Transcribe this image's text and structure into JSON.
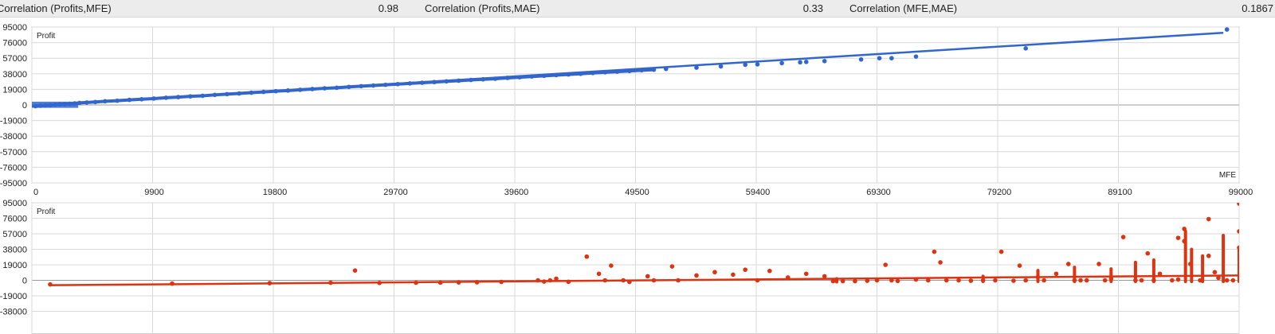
{
  "stats": [
    {
      "label": "Correlation (Profits,MFE)",
      "value": "0.98"
    },
    {
      "label": "Correlation (Profits,MAE)",
      "value": "0.33"
    },
    {
      "label": "Correlation (MFE,MAE)",
      "value": "0.1867"
    }
  ],
  "colors": {
    "mfe_series": "#3366cc",
    "mae_series": "#dd3311",
    "grid": "#d9d9d9",
    "axis": "#9a9a9a"
  },
  "chart_data": [
    {
      "type": "scatter",
      "title": "",
      "ylabel": "Profit",
      "xlabel": "MFE",
      "ylim": [
        -95000,
        95000
      ],
      "xlim": [
        0,
        99000
      ],
      "yticks": [
        95000,
        76000,
        57000,
        38000,
        19000,
        0,
        -19000,
        -38000,
        -57000,
        -76000,
        -95000
      ],
      "yticklabels": [
        "95000",
        "76000",
        "57000",
        "38000",
        "19000",
        "0",
        "-19000",
        "-38000",
        "-57000",
        "-76000",
        "-95000"
      ],
      "xticks": [
        0,
        9900,
        19800,
        29700,
        39600,
        49500,
        59400,
        69300,
        79200,
        89100,
        99000
      ],
      "xticklabels": [
        "0",
        "9900",
        "19800",
        "29700",
        "39600",
        "49500",
        "59400",
        "69300",
        "79200",
        "89100",
        "99000"
      ],
      "grid": true,
      "trendline": {
        "x": [
          0,
          97700
        ],
        "y": [
          -1500,
          88000
        ]
      },
      "points": [
        [
          300,
          -1500
        ],
        [
          700,
          -900
        ],
        [
          1100,
          -400
        ],
        [
          1500,
          -300
        ],
        [
          1900,
          300
        ],
        [
          2300,
          800
        ],
        [
          2700,
          1100
        ],
        [
          3100,
          1400
        ],
        [
          3500,
          1900
        ],
        [
          3900,
          2500
        ],
        [
          4500,
          3000
        ],
        [
          5200,
          3600
        ],
        [
          6000,
          4500
        ],
        [
          7000,
          5200
        ],
        [
          8000,
          6200
        ],
        [
          9000,
          7000
        ],
        [
          10000,
          7800
        ],
        [
          11000,
          8800
        ],
        [
          12000,
          9600
        ],
        [
          13000,
          10500
        ],
        [
          14000,
          11200
        ],
        [
          15000,
          12300
        ],
        [
          16000,
          13200
        ],
        [
          17000,
          14000
        ],
        [
          18000,
          15000
        ],
        [
          19000,
          15900
        ],
        [
          20000,
          16800
        ],
        [
          21000,
          17600
        ],
        [
          22000,
          18500
        ],
        [
          23000,
          19400
        ],
        [
          24000,
          20300
        ],
        [
          25000,
          21000
        ],
        [
          26000,
          22000
        ],
        [
          27000,
          22900
        ],
        [
          28000,
          23700
        ],
        [
          29000,
          24600
        ],
        [
          30000,
          25400
        ],
        [
          31000,
          26300
        ],
        [
          32000,
          27100
        ],
        [
          33000,
          27900
        ],
        [
          34000,
          28800
        ],
        [
          35000,
          29600
        ],
        [
          36000,
          30500
        ],
        [
          37000,
          31300
        ],
        [
          38000,
          32000
        ],
        [
          39000,
          33000
        ],
        [
          40000,
          33800
        ],
        [
          41000,
          34700
        ],
        [
          42000,
          35500
        ],
        [
          43000,
          36400
        ],
        [
          44000,
          37200
        ],
        [
          45000,
          38000
        ],
        [
          46000,
          39000
        ],
        [
          47000,
          39800
        ],
        [
          48000,
          40600
        ],
        [
          49000,
          41400
        ],
        [
          50000,
          42300
        ],
        [
          51000,
          43000
        ],
        [
          52000,
          44000
        ],
        [
          54500,
          45500
        ],
        [
          56500,
          47000
        ],
        [
          58500,
          49000
        ],
        [
          59500,
          49500
        ],
        [
          61500,
          51000
        ],
        [
          63000,
          52000
        ],
        [
          63500,
          52500
        ],
        [
          65000,
          53500
        ],
        [
          68000,
          55500
        ],
        [
          69500,
          57000
        ],
        [
          70500,
          57000
        ],
        [
          72500,
          59000
        ],
        [
          81500,
          69000
        ],
        [
          98000,
          92000
        ]
      ]
    },
    {
      "type": "scatter",
      "title": "",
      "ylabel": "Profit",
      "xlabel": "",
      "ylim": [
        -95000,
        95000
      ],
      "xlim": [
        0,
        99000
      ],
      "yticks": [
        95000,
        76000,
        57000,
        38000,
        19000,
        0,
        -19000,
        -38000
      ],
      "yticklabels": [
        "95000",
        "76000",
        "57000",
        "38000",
        "19000",
        "0",
        "-19000",
        "-38000"
      ],
      "grid": true,
      "trendline": {
        "x": [
          1500,
          99000
        ],
        "y": [
          -6000,
          6000
        ]
      },
      "points": [
        [
          1500,
          -5000
        ],
        [
          11500,
          -4000
        ],
        [
          19500,
          -3500
        ],
        [
          24500,
          -3000
        ],
        [
          26500,
          12000
        ],
        [
          28500,
          -3200
        ],
        [
          31500,
          -3000
        ],
        [
          33500,
          -2800
        ],
        [
          35000,
          -2600
        ],
        [
          36500,
          -2400
        ],
        [
          38500,
          -2000
        ],
        [
          41500,
          0
        ],
        [
          42000,
          -1500
        ],
        [
          42500,
          0
        ],
        [
          43000,
          2000
        ],
        [
          44000,
          -1800
        ],
        [
          45500,
          29000
        ],
        [
          46500,
          8000
        ],
        [
          47000,
          0
        ],
        [
          47500,
          18000
        ],
        [
          48500,
          0
        ],
        [
          49000,
          -2000
        ],
        [
          50500,
          5000
        ],
        [
          51000,
          0
        ],
        [
          52500,
          17000
        ],
        [
          53000,
          0
        ],
        [
          54500,
          6000
        ],
        [
          56000,
          10000
        ],
        [
          57500,
          7000
        ],
        [
          58500,
          13000
        ],
        [
          59500,
          0
        ],
        [
          60500,
          11500
        ],
        [
          62000,
          3500
        ],
        [
          63500,
          8000
        ],
        [
          65000,
          5000
        ],
        [
          65700,
          -1000
        ],
        [
          66500,
          -1000
        ],
        [
          67500,
          -1000
        ],
        [
          68500,
          -500
        ],
        [
          69300,
          0
        ],
        [
          70000,
          19000
        ],
        [
          70500,
          0
        ],
        [
          71000,
          -800
        ],
        [
          72500,
          1000
        ],
        [
          73500,
          0
        ],
        [
          74000,
          35000
        ],
        [
          74500,
          22000
        ],
        [
          75000,
          0
        ],
        [
          76000,
          0
        ],
        [
          77000,
          -500
        ],
        [
          78000,
          0
        ],
        [
          79000,
          0
        ],
        [
          79500,
          35000
        ],
        [
          80500,
          -500
        ],
        [
          81000,
          18000
        ],
        [
          81500,
          0
        ],
        [
          82500,
          4000
        ],
        [
          83000,
          0
        ],
        [
          84000,
          8000
        ],
        [
          85000,
          20000
        ],
        [
          85500,
          0
        ],
        [
          86000,
          0
        ],
        [
          86500,
          0
        ],
        [
          87500,
          20000
        ],
        [
          88000,
          0
        ],
        [
          88500,
          2000
        ],
        [
          89500,
          53000
        ],
        [
          90500,
          0
        ],
        [
          91000,
          0
        ],
        [
          91500,
          33000
        ],
        [
          92000,
          0
        ],
        [
          92500,
          8000
        ],
        [
          93500,
          0
        ],
        [
          94000,
          1000
        ],
        [
          94500,
          48000
        ],
        [
          95000,
          20000
        ],
        [
          95800,
          0
        ],
        [
          96500,
          30000
        ],
        [
          97000,
          10000
        ],
        [
          97300,
          3000
        ],
        [
          98000,
          0
        ],
        [
          98500,
          0
        ],
        [
          99000,
          94000
        ],
        [
          99000,
          60000
        ],
        [
          99000,
          40000
        ],
        [
          96500,
          75000
        ],
        [
          94500,
          63000
        ],
        [
          94000,
          52000
        ]
      ],
      "columns": [
        {
          "x": 66000,
          "y0": -2000,
          "y1": 2000
        },
        {
          "x": 78000,
          "y0": -1500,
          "y1": 5000
        },
        {
          "x": 82500,
          "y0": -1500,
          "y1": 12000
        },
        {
          "x": 85500,
          "y0": -1500,
          "y1": 16000
        },
        {
          "x": 88500,
          "y0": -1500,
          "y1": 14000
        },
        {
          "x": 90500,
          "y0": -1500,
          "y1": 22000
        },
        {
          "x": 92000,
          "y0": -1500,
          "y1": 25000
        },
        {
          "x": 94600,
          "y0": -1500,
          "y1": 60000
        },
        {
          "x": 95100,
          "y0": -1500,
          "y1": 38000
        },
        {
          "x": 96000,
          "y0": -1500,
          "y1": 30000
        },
        {
          "x": 97700,
          "y0": -1500,
          "y1": 55000
        },
        {
          "x": 99000,
          "y0": -1500,
          "y1": 38000
        }
      ]
    }
  ]
}
